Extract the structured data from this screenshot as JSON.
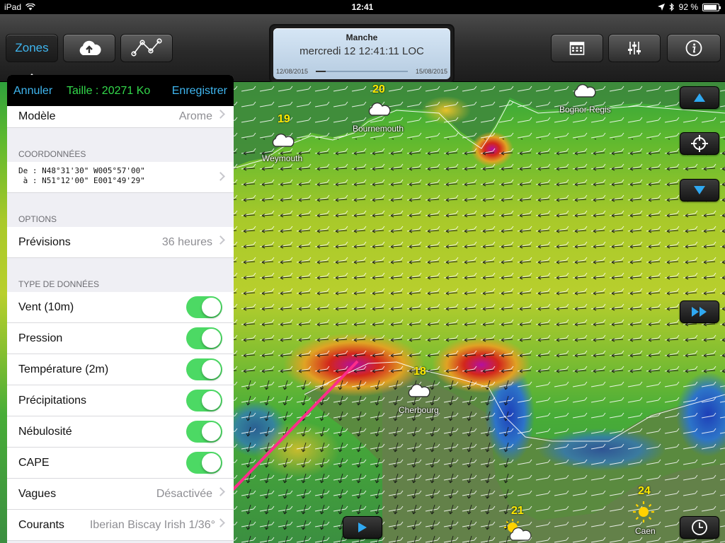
{
  "status": {
    "device": "iPad",
    "time": "12:41",
    "battery": "92 %",
    "battery_level": 0.92
  },
  "toolbar": {
    "zones_label": "Zones",
    "zone_name": "Manche",
    "datetime": "mercredi 12 12:41:11 LOC",
    "start_date": "12/08/2015",
    "end_date": "15/08/2015"
  },
  "map": {
    "cities": [
      {
        "name": "Weymouth",
        "temp": "19"
      },
      {
        "name": "Bournemouth",
        "temp": "20"
      },
      {
        "name": "Bognor Regis",
        "temp": ""
      },
      {
        "name": "Cherbourg",
        "temp": "18"
      },
      {
        "name": "Caen",
        "temp": "24"
      }
    ],
    "extra_temp": "21"
  },
  "panel": {
    "cancel": "Annuler",
    "size": "Taille : 20271 Ko",
    "save": "Enregistrer",
    "model_label": "Modèle",
    "model_value": "Arome",
    "coords_header": "COORDONNÉES",
    "coords_from": "De : N48°31'30\" W005°57'00\"",
    "coords_to": " à : N51°12'00\" E001°49'29\"",
    "options_header": "OPTIONS",
    "forecast_label": "Prévisions",
    "forecast_value": "36 heures",
    "datatype_header": "TYPE DE DONNÉES",
    "toggles": [
      "Vent (10m)",
      "Pression",
      "Température (2m)",
      "Précipitations",
      "Nébulosité",
      "CAPE"
    ],
    "waves_label": "Vagues",
    "waves_value": "Désactivée",
    "currents_label": "Courants",
    "currents_value": "Iberian Biscay Irish 1/36°"
  },
  "colors": {
    "accent": "#3fb6f0",
    "size_green": "#33d94b",
    "toggle_on": "#4cd964",
    "arrow": "#ff2d8a"
  }
}
